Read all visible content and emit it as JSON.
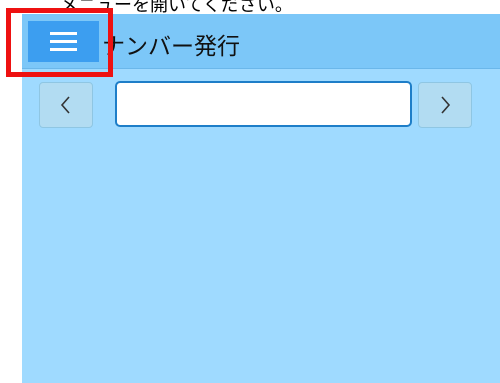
{
  "caption": {
    "text": "メニューを開いてください。"
  },
  "header": {
    "title": "ナンバー発行",
    "menu_icon": "hamburger-icon"
  },
  "navigator": {
    "prev_glyph": "‹",
    "next_glyph": "›",
    "input_value": "",
    "input_placeholder": ""
  },
  "colors": {
    "background": "#9fdaff",
    "header": "#7cc7f8",
    "menu_button": "#3c9ef0",
    "highlight": "#ee1111"
  }
}
